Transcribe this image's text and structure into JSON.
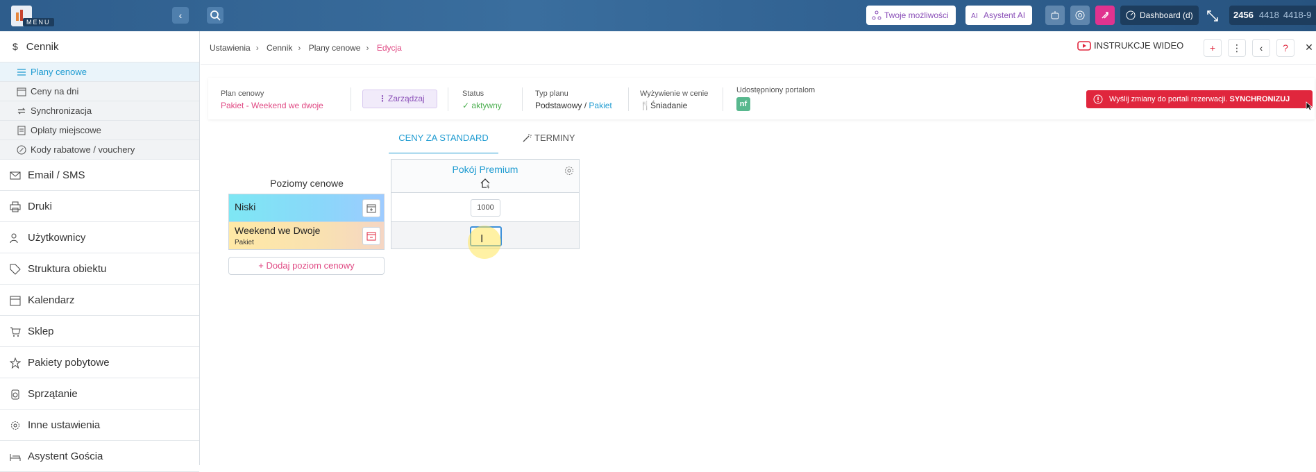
{
  "topbar": {
    "menu_label": "MENU",
    "collapse_glyph": "‹",
    "possibilities_label": "Twoje możliwości",
    "ai_label": "Asystent AI",
    "dashboard_label": "Dashboard (d)",
    "counters": [
      "2456",
      "4418",
      "4418-9"
    ]
  },
  "sidebar": {
    "section_title": "Cennik",
    "sub_items": [
      {
        "label": "Plany cenowe",
        "icon": "list-icon",
        "active": true
      },
      {
        "label": "Ceny na dni",
        "icon": "calendar-icon",
        "active": false
      },
      {
        "label": "Synchronizacja",
        "icon": "sync-icon",
        "active": false
      },
      {
        "label": "Opłaty miejscowe",
        "icon": "receipt-icon",
        "active": false
      },
      {
        "label": "Kody rabatowe / vouchery",
        "icon": "percent-icon",
        "active": false
      }
    ],
    "items": [
      {
        "label": "Email / SMS",
        "icon": "mail-icon"
      },
      {
        "label": "Druki",
        "icon": "printer-icon"
      },
      {
        "label": "Użytkownicy",
        "icon": "users-icon"
      },
      {
        "label": "Struktura obiektu",
        "icon": "tag-icon"
      },
      {
        "label": "Kalendarz",
        "icon": "calendar-icon"
      },
      {
        "label": "Sklep",
        "icon": "cart-icon"
      },
      {
        "label": "Pakiety pobytowe",
        "icon": "star-icon"
      },
      {
        "label": "Sprzątanie",
        "icon": "broom-icon"
      },
      {
        "label": "Inne ustawienia",
        "icon": "gear-icon"
      },
      {
        "label": "Asystent Gościa",
        "icon": "bed-icon"
      }
    ]
  },
  "breadcrumb": {
    "items": [
      "Ustawienia",
      "Cennik",
      "Plany cenowe"
    ],
    "current": "Edycja"
  },
  "video_label": "INSTRUKCJE WIDEO",
  "info": {
    "plan_key": "Plan cenowy",
    "plan_value": "Pakiet - Weekend we dwoje",
    "manage_label": "Zarządzaj",
    "status_key": "Status",
    "status_value": "aktywny",
    "type_key": "Typ planu",
    "type_value_a": "Podstawowy",
    "type_sep": " / ",
    "type_value_b": "Pakiet",
    "meal_key": "Wyżywienie w cenie",
    "meal_value": "Śniadanie",
    "portals_key": "Udostępniony portalom",
    "portal_badge": "nf"
  },
  "sync": {
    "message": "Wyślij zmiany do portali rezerwacji.",
    "action": "SYNCHRONIZUJ"
  },
  "tabs": {
    "active": "CENY ZA STANDARD",
    "other": "TERMINY"
  },
  "levels": {
    "title": "Poziomy cenowe",
    "rows": [
      {
        "name": "Niski",
        "sub": ""
      },
      {
        "name": "Weekend we Dwoje",
        "sub": "Pakiet"
      }
    ],
    "add_label": "+ Dodaj poziom cenowy"
  },
  "grid": {
    "room": "Pokój Premium",
    "values": [
      "1000",
      ""
    ]
  },
  "colors": {
    "accent": "#1e9bd1",
    "pink": "#e04a84",
    "sync_red": "#e0263d",
    "topbar": "#2e5d8c"
  }
}
